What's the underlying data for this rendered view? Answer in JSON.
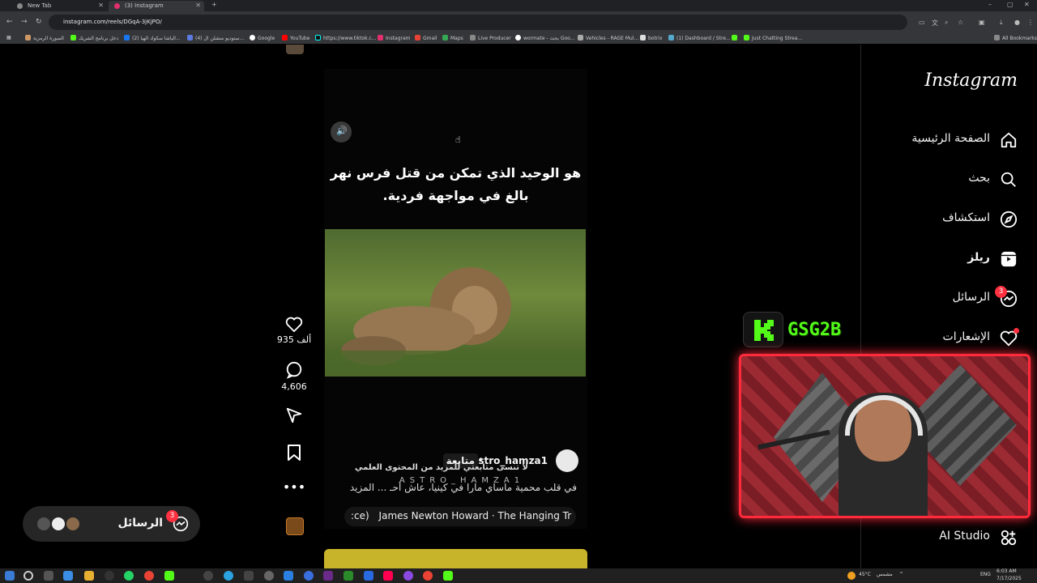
{
  "browser": {
    "tabs": [
      {
        "label": "New Tab",
        "active": false
      },
      {
        "label": "(3) Instagram",
        "active": true
      }
    ],
    "url": "instagram.com/reels/DGqA-3jKjPO/",
    "bookmarks": [
      "الصورة الرمزية",
      "دخل برنامج الشريك",
      "(2) الياشا سكواد الهيا...",
      "(4) ستوديو منشلن ال...",
      "Google",
      "YouTube",
      "https://www.tiktok.c...",
      "Instagram",
      "Gmail",
      "Maps",
      "Live Producer",
      "wormate - بحث Goo...",
      "Vehicles - RAGE Mul...",
      "botrix",
      "(1) Dashboard / Stre...",
      "Just Chatting Strea..."
    ],
    "all_bookmarks_label": "All Bookmarks"
  },
  "sidebar": {
    "logo": "Instagram",
    "items": [
      {
        "label": "الصفحة الرئيسية",
        "icon": "home-icon"
      },
      {
        "label": "بحث",
        "icon": "search-icon"
      },
      {
        "label": "استكشاف",
        "icon": "compass-icon"
      },
      {
        "label": "ريلز",
        "icon": "reels-icon"
      },
      {
        "label": "الرسائل",
        "icon": "messenger-icon",
        "badge": "3"
      },
      {
        "label": "الإشعارات",
        "icon": "heart-icon"
      },
      {
        "label": "AI Studio",
        "icon": "ai-studio-icon"
      }
    ]
  },
  "reel": {
    "overlay_text": "هو الوحيد الذي تمكن من قتل فرس نهر بالغ في مواجهة فردية.",
    "likes": "935 ألف",
    "comments": "4,606",
    "username": "astro_hamza1",
    "follow_label": "متابعة",
    "subtitle": "لا تنسى متابعتي للمزيد من المحتوى العلمي",
    "watermark": "ASTRO_HAMZA1",
    "caption": "في قلب محمية ماساي مارا في كينيا، عاش أحـ ... المزيد",
    "music": "James Newton Howard · The Hanging Tr",
    "music_prefix": ":ce)"
  },
  "messages_pill": {
    "label": "الرسائل",
    "badge": "3"
  },
  "stream_overlay": {
    "channel_name": "GSG2B",
    "brand_color": "#53fc18",
    "frame_color": "#ff2a3c"
  },
  "taskbar": {
    "weather": "45°C",
    "weather_label": "مشمس",
    "language": "ENG",
    "time": "6:03 AM",
    "date": "7/17/2025"
  }
}
